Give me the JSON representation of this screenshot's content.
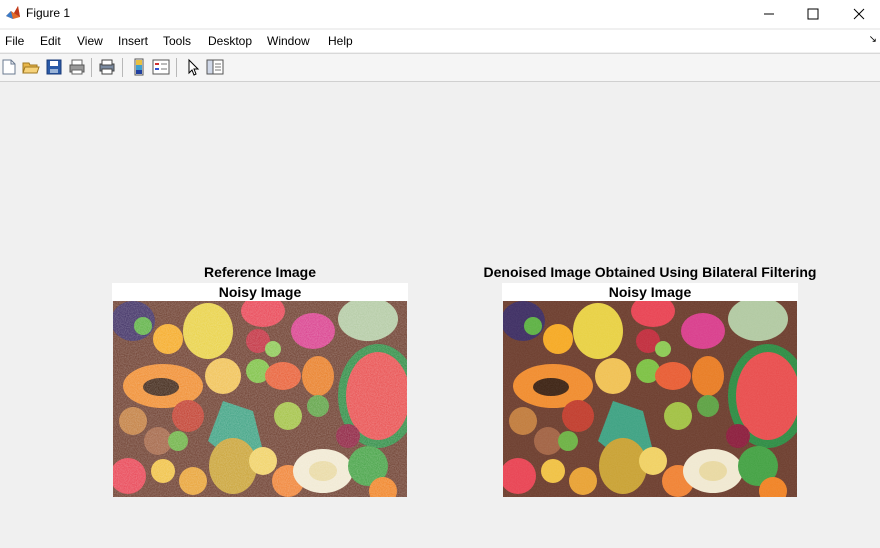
{
  "window": {
    "title": "Figure 1",
    "app_icon": "matlab-icon",
    "controls": [
      "minimize-icon",
      "maximize-icon",
      "close-icon"
    ]
  },
  "menu": {
    "items": [
      "File",
      "Edit",
      "View",
      "Insert",
      "Tools",
      "Desktop",
      "Window",
      "Help"
    ]
  },
  "toolbar": {
    "buttons": [
      "new-figure-icon",
      "open-file-icon",
      "save-icon",
      "print-icon",
      "print-preview-icon",
      "colorbar-icon",
      "legend-icon",
      "select-pointer-icon",
      "property-inspector-icon"
    ]
  },
  "plots": [
    {
      "title": "Reference Image",
      "subtitle": "Noisy Image",
      "image": "fruit-photo-noisy"
    },
    {
      "title": "Denoised Image Obtained Using Bilateral Filtering",
      "subtitle": "Noisy Image",
      "image": "fruit-photo-denoised"
    }
  ]
}
